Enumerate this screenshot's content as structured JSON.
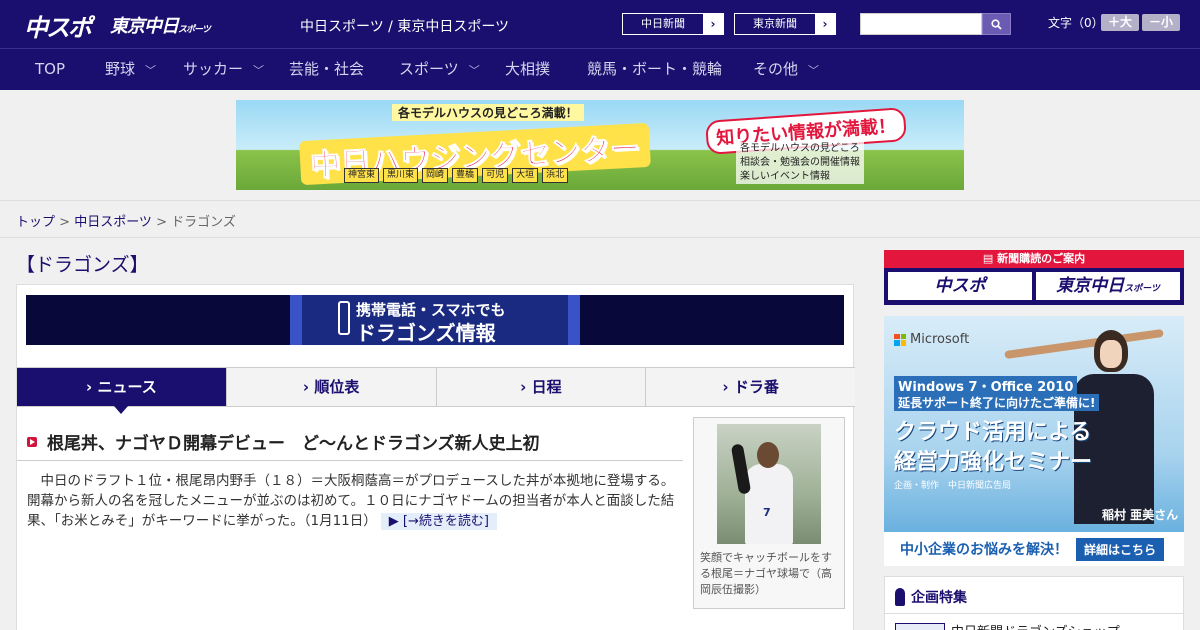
{
  "header": {
    "logo_main": "中スポ",
    "logo_tokyo": "東京中日",
    "logo_tokyo_suffix": "スポーツ",
    "site_links": "中日スポーツ / 東京中日スポーツ",
    "paper_buttons": [
      {
        "label": "中日新聞",
        "arrow": "›"
      },
      {
        "label": "東京新聞",
        "arrow": "›"
      }
    ],
    "search_value": "",
    "font_size_label": "文字（0）",
    "font_bigger": "＋大",
    "font_smaller": "－小"
  },
  "nav": {
    "items": [
      {
        "label": "TOP",
        "has_menu": false
      },
      {
        "label": "野球",
        "has_menu": true
      },
      {
        "label": "サッカー",
        "has_menu": true
      },
      {
        "label": "芸能・社会",
        "has_menu": false
      },
      {
        "label": "スポーツ",
        "has_menu": true
      },
      {
        "label": "大相撲",
        "has_menu": false
      },
      {
        "label": "競馬・ボート・競輪",
        "has_menu": false
      },
      {
        "label": "その他",
        "has_menu": true
      }
    ]
  },
  "ad_banner": {
    "top_text": "各モデルハウスの見どころ満載！",
    "title": "中日ハウジングセンター",
    "right_badge": "知りたい情報が満載！",
    "list": [
      "各モデルハウスの見どころ",
      "相談会・勉強会の開催情報",
      "楽しいイベント情報"
    ],
    "places": [
      "神宮東",
      "黒川東",
      "岡崎",
      "豊橋",
      "可児",
      "大垣",
      "浜北"
    ]
  },
  "breadcrumb": {
    "top": "トップ",
    "sep1": " > ",
    "chunichi": "中日スポーツ",
    "sep2": " > ",
    "current": "ドラゴンズ"
  },
  "section_title": "【ドラゴンズ】",
  "mobile_banner": {
    "line1": "携帯電話・スマホでも",
    "line2": "ドラゴンズ情報"
  },
  "tabs": [
    {
      "label": "› ニュース",
      "active": true
    },
    {
      "label": "› 順位表",
      "active": false
    },
    {
      "label": "› 日程",
      "active": false
    },
    {
      "label": "› ドラ番",
      "active": false
    }
  ],
  "article": {
    "headline": "根尾丼、ナゴヤＤ開幕デビュー　ど～んとドラゴンズ新人史上初",
    "body": "　中日のドラフト１位・根尾昂内野手（１８）＝大阪桐蔭高＝がプロデュースした丼が本拠地に登場する。開幕から新人の名を冠したメニューが並ぶのは初めて。１０日にナゴヤドームの担当者が本人と面談した結果、「お米とみそ」がキーワードに挙がった。（1月11日）",
    "read_more": "▶ [→続きを読む]",
    "photo_caption": "笑顔でキャッチボールをする根尾＝ナゴヤ球場で（高岡辰伍撮影）",
    "player_number": "7"
  },
  "sidebar": {
    "subscribe_head": "新聞購読のご案内",
    "subscribe_logos": [
      "中スポ",
      "東京中日"
    ],
    "subscribe_logo_suffix": "スポーツ",
    "ms_ad": {
      "brand": "Microsoft",
      "line1": "Windows 7・Office 2010",
      "line2": "延長サポート終了に向けたご準備に!",
      "line3": "クラウド活用による経営力強化セミナー",
      "line4": "企画・制作　中日新聞広告局",
      "person": "稲村 亜美さん",
      "bottom_text": "中小企業のお悩みを解決！",
      "bottom_button": "詳細はこちら"
    },
    "kikaku_title": "企画特集",
    "kikaku_item": "中日新聞ドラゴンズショップ"
  },
  "colors": {
    "brand_navy": "#1a0e6e",
    "accent_red": "#e3173e"
  }
}
